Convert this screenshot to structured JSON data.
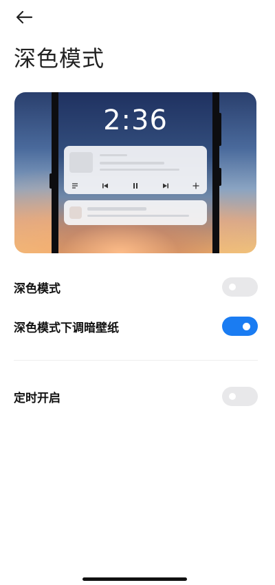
{
  "header": {
    "back_icon": "arrow-left-icon",
    "title": "深色模式"
  },
  "preview": {
    "clock_time": "2:36",
    "music_controls": [
      "list-icon",
      "skip-previous-icon",
      "pause-icon",
      "skip-next-icon",
      "plus-icon"
    ]
  },
  "settings": {
    "dark_mode": {
      "label": "深色模式",
      "enabled": false
    },
    "dim_wallpaper": {
      "label": "深色模式下调暗壁纸",
      "enabled": true
    },
    "scheduled": {
      "label": "定时开启",
      "enabled": false
    }
  },
  "colors": {
    "accent": "#1a7cf2",
    "toggle_off": "#e8e8ea",
    "text": "#111111"
  }
}
